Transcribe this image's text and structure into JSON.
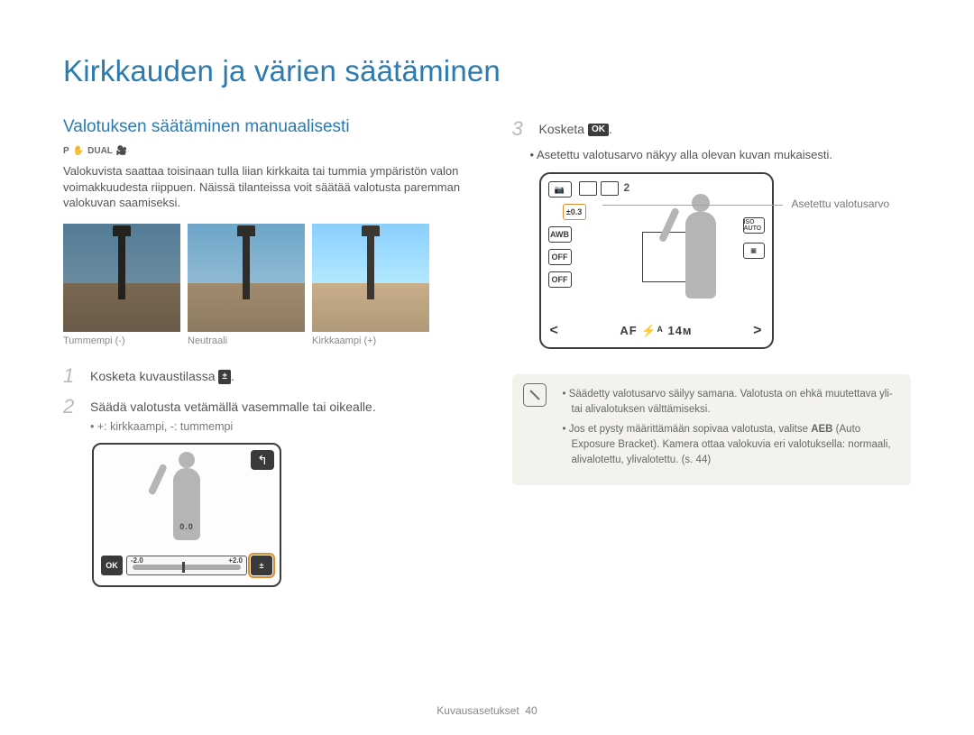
{
  "page": {
    "title": "Kirkkauden ja värien säätäminen",
    "footer_section": "Kuvausasetukset",
    "footer_page": "40"
  },
  "left": {
    "section_title": "Valotuksen säätäminen manuaalisesti",
    "mode_icons": [
      "P",
      "✋",
      "DUAL",
      "🎥"
    ],
    "intro": "Valokuvista saattaa toisinaan tulla liian kirkkaita tai tummia ympäristön valon voimakkuudesta riippuen. Näissä tilanteissa voit säätää valotusta paremman valokuvan saamiseksi.",
    "thumb_labels": [
      "Tummempi (-)",
      "Neutraali",
      "Kirkkaampi (+)"
    ],
    "step1_num": "1",
    "step1_text_a": "Kosketa kuvaustilassa ",
    "step1_text_b": ".",
    "step2_num": "2",
    "step2_text": "Säädä valotusta vetämällä vasemmalle tai oikealle.",
    "step2_sub": "+: kirkkaampi, -: tummempi",
    "screen": {
      "back": "↰",
      "value": "0.0",
      "ok": "OK",
      "neg": "-2.0",
      "pos": "+2.0",
      "ev": "±"
    }
  },
  "right": {
    "step3_num": "3",
    "step3_text_a": "Kosketa ",
    "step3_ok": "OK",
    "step3_text_b": ".",
    "bullet": "Asetettu valotusarvo näkyy alla olevan kuvan mukaisesti.",
    "callout": "Asetettu valotusarvo",
    "screen": {
      "top_right_count": "2",
      "ev_value": "0.3",
      "awb": "AWB",
      "off1": "OFF",
      "off2": "OFF",
      "iso": "ISO AUTO",
      "bottom": "AF   ⚡ᴬ   14ᴍ"
    },
    "tips": {
      "t1": "Säädetty valotusarvo säilyy samana. Valotusta on ehkä muutettava yli- tai alivalotuksen välttämiseksi.",
      "t2_a": "Jos et pysty määrittämään sopivaa valotusta, valitse ",
      "t2_aeb": "AEB",
      "t2_b": " (Auto Exposure Bracket). Kamera ottaa valokuvia eri valotuksella: normaali, alivalotettu, ylivalotettu. (s. 44)"
    }
  }
}
